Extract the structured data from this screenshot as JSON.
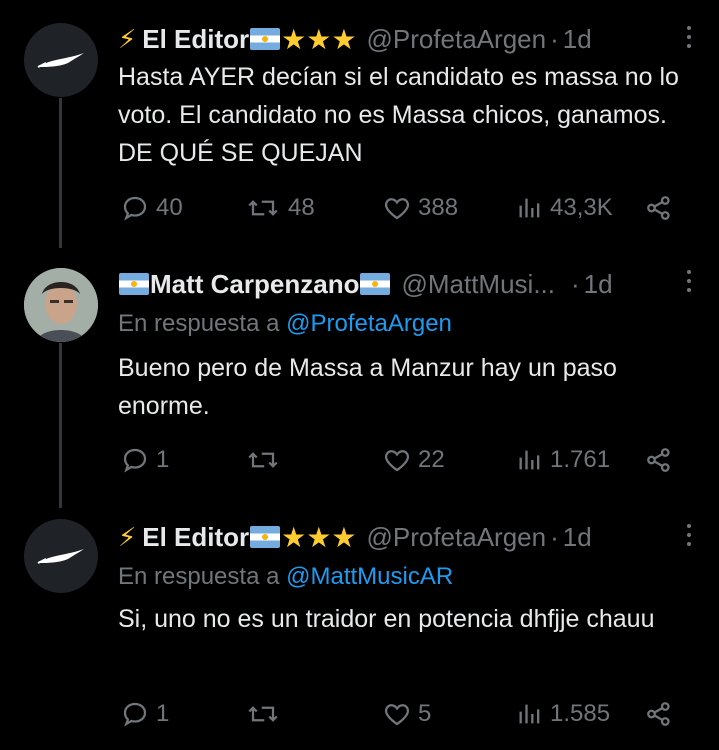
{
  "tweets": [
    {
      "display_name": "El Editor",
      "name_prefix": "⚡",
      "name_suffix": "★★★",
      "handle": "@ProfetaArgen",
      "time": "1d",
      "reply_label": "",
      "reply_handle": "",
      "text": "Hasta AYER decían si el candidato es massa no lo voto. El candidato no es Massa chicos, ganamos. DE QUÉ SE QUEJAN",
      "replies": "40",
      "retweets": "48",
      "likes": "388",
      "views": "43,3K"
    },
    {
      "display_name": "Matt Carpenzano",
      "name_prefix": "",
      "name_suffix": "",
      "handle": "@MattMusi...",
      "time": "1d",
      "reply_label": "En respuesta a",
      "reply_handle": "@ProfetaArgen",
      "text": "Bueno pero de Massa a Manzur hay un paso enorme.",
      "replies": "1",
      "retweets": "",
      "likes": "22",
      "views": "1.761"
    },
    {
      "display_name": "El Editor",
      "name_prefix": "⚡",
      "name_suffix": "★★★",
      "handle": "@ProfetaArgen",
      "time": "1d",
      "reply_label": "En respuesta a",
      "reply_handle": "@MattMusicAR",
      "text": "Si, uno no es un traidor en potencia dhfjje chauu",
      "replies": "1",
      "retweets": "",
      "likes": "5",
      "views": "1.585"
    }
  ],
  "separator": "·",
  "colors": {
    "background": "#000000",
    "text": "#e7e9ea",
    "muted": "#71767b",
    "link": "#1d9bf0",
    "star": "#ffcc30"
  }
}
